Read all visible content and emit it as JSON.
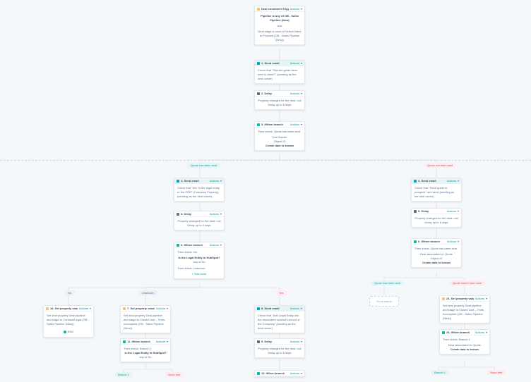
{
  "labels": {
    "actions": "Actions",
    "and": "and"
  },
  "trigger": {
    "title": "Deal enrollment trigger",
    "body_l1": "Pipeline is any of OB - Sales Pipeline (New)",
    "body_l2": "and",
    "body_l3": "Deal stage is none of Verbal Intent to Proceed (OB - Sales Pipeline (New))"
  },
  "n2": {
    "header": "1. Send email",
    "body_l1": "Check that \"Has the guide been sent to client?\" (sending as the deal owner)"
  },
  "n3": {
    "header": "2. Delay",
    "body_l1": "Property changed for the deal: null",
    "body_l2": "Delay up to 6 days"
  },
  "n4": {
    "header": "3. If/then branch",
    "body_l1": "Then check: Quote has been sent",
    "list_l1": "One Bundle",
    "list_l2": "Object ID",
    "list_l3": "Create date is known"
  },
  "left_b1_label": "Quote has been sent",
  "right_b1_label": "Quote not been sent",
  "n5L": {
    "header": "4. Send email",
    "body": "Check that \"Set To the legal entity or the CRD\" (Company Property) (sending as the deal owner)"
  },
  "n6L": {
    "header": "5. Delay",
    "body_l1": "Property changed for the deal: null",
    "body_l2": "Delay up to 4 days"
  },
  "n7L": {
    "header": "6. If/then branch",
    "body_l1": "Then check: No",
    "q": "Is the Legal Entity in HubSpot?",
    "ans": "any of No",
    "unknown": "Then check: Unknown",
    "seemore": "+ See more"
  },
  "left_b2_no": "No",
  "left_b2_unknown": "Unknown",
  "left_b2_yes": "Yes",
  "n8L": {
    "header": "18. Set property value",
    "body": "Set deal property Deal pipeline and stage to Contract/Legal (OB - Sales Pipeline (New))",
    "end": "END"
  },
  "n9L": {
    "header": "7. Set property value",
    "body": "Set deal property Deal pipeline and stage to Closed Lost – Texts, Incomplete (OB - Sales Pipeline (New))"
  },
  "n10L": {
    "header": "11. If/then branch",
    "body_l1": "Then check: Branch 1",
    "q": "Is the Legal Entity in HubSpot?",
    "ans": "any of No"
  },
  "n10L_b1": "Branch 1",
  "n10L_none": "None met",
  "n5C": {
    "header": "8. Send email",
    "body": "Check that \"Add Legal Entity into the associated contact's record of the Company\" (sending as the deal owner)"
  },
  "n6C": {
    "header": "9. Delay",
    "body_l1": "Property changed for the deal: null",
    "body_l2": "Delay up to 6 days"
  },
  "n7C": {
    "header": "10. If/then branch"
  },
  "n5R": {
    "header": "4. Send email",
    "body": "Check that \"Send guide to prospect\" and send (sending as the deal owner)"
  },
  "n6R": {
    "header": "5. Delay",
    "body_l1": "Property changed for the deal: null",
    "body_l2": "Delay up to 6 days"
  },
  "n7R": {
    "header": "6. If/then branch",
    "body_l1": "Then check: Quote has been sent",
    "list_l1": "Deal associated to: Quote",
    "list_l2": "Object ID",
    "list_l3": "Create date is known"
  },
  "r_b_sent": "Quote has been sent",
  "r_b_notsent": "Quote hasn't been sent",
  "goto": "Go to action",
  "n8R": {
    "header": "23. Set property value",
    "body": "Set deal property Deal pipeline and stage to Closed Lost – Texts, Incomplete (OB - Sales Pipeline (New))"
  },
  "n9R": {
    "header": "24. If/then branch",
    "body_l1": "Then check: Branch 1",
    "list_l1": "Deal associated to: Quote",
    "list_l2": "Create date is known"
  },
  "n9R_b1": "Branch 1",
  "n9R_none": "None met"
}
